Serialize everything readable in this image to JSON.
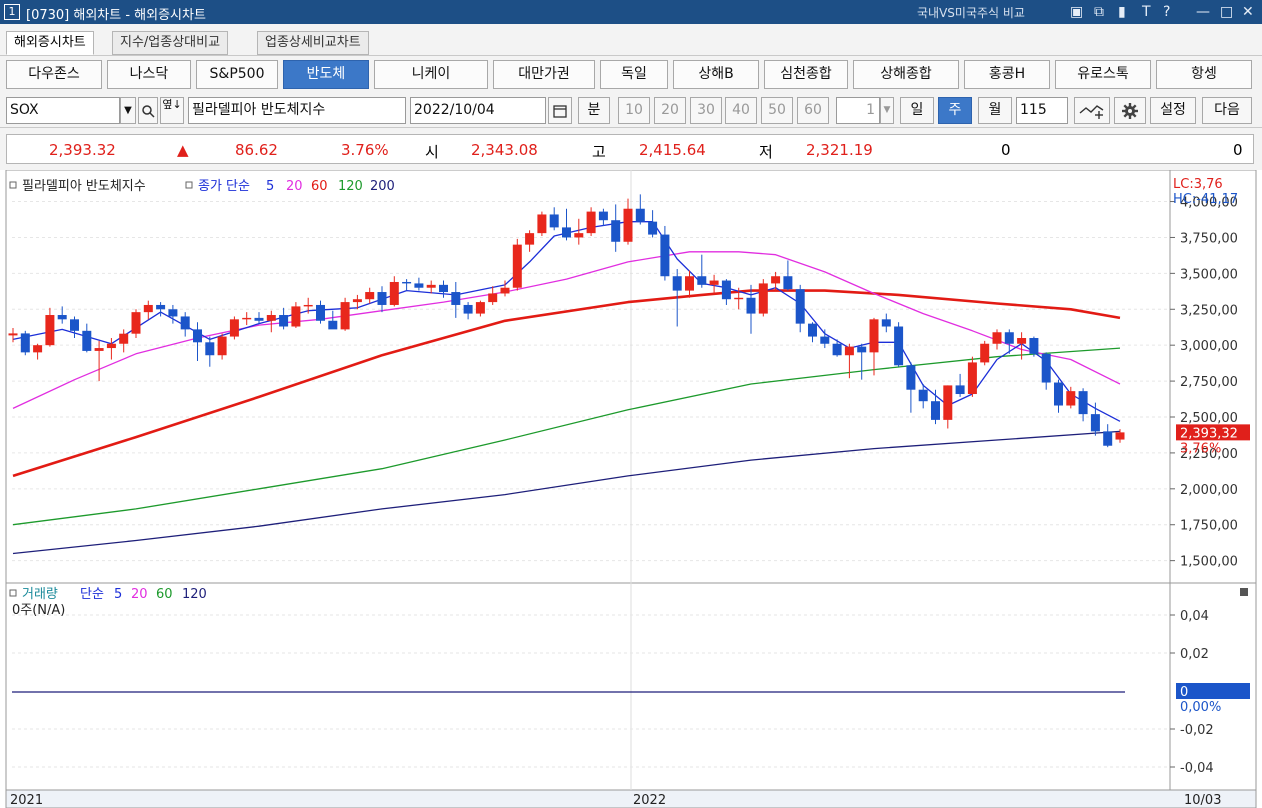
{
  "window": {
    "number": "1",
    "title": "[0730] 해외차트 - 해외증시차트",
    "compare_link": "국내VS미국주식 비교",
    "controls": [
      "▣",
      "⧉",
      "▮",
      "T",
      "?",
      "—",
      "□",
      "✕"
    ]
  },
  "tabs": [
    {
      "label": "해외증시차트",
      "active": true
    },
    {
      "label": "지수/업종상대비교",
      "active": false
    },
    {
      "label": "업종상세비교차트",
      "active": false
    }
  ],
  "index_buttons": [
    {
      "label": "다우존스"
    },
    {
      "label": "나스닥"
    },
    {
      "label": "S&P500"
    },
    {
      "label": "반도체",
      "active": true
    },
    {
      "label": "니케이"
    },
    {
      "label": "대만가권"
    },
    {
      "label": "독일"
    },
    {
      "label": "상해B"
    },
    {
      "label": "심천종합"
    },
    {
      "label": "상해종합"
    },
    {
      "label": "홍콩H"
    },
    {
      "label": "유로스톡"
    },
    {
      "label": "항셍"
    }
  ],
  "toolbar": {
    "symbol": "SOX",
    "symbol_name": "필라델피아 반도체지수",
    "date": "2022/10/04",
    "minute_label": "분",
    "minute_options": [
      "10",
      "20",
      "30",
      "40",
      "50",
      "60"
    ],
    "period_value": "1",
    "day_label": "일",
    "week_label": "주",
    "month_label": "월",
    "count_value": "115",
    "settings_label": "설정",
    "next_label": "다음"
  },
  "quote": {
    "price": "2,393.32",
    "change_arrow": "▲",
    "change": "86.62",
    "change_pct": "3.76%",
    "open_label": "시",
    "open": "2,343.08",
    "high_label": "고",
    "high": "2,415.64",
    "low_label": "저",
    "low": "2,321.19",
    "volume": "0",
    "amount": "0"
  },
  "chart_data": {
    "type": "candlestick",
    "price_legend": {
      "title": "필라델피아 반도체지수",
      "series_label": "종가 단순",
      "periods": [
        "5",
        "20",
        "60",
        "120",
        "200"
      ]
    },
    "volume_legend": {
      "title": "거래량",
      "series_label": "단순",
      "periods": [
        "5",
        "20",
        "60",
        "120"
      ],
      "subtitle": "0주(N/A)"
    },
    "price_axis": {
      "min": 1400,
      "max": 4150,
      "ticks": [
        "1,500,00",
        "1,750,00",
        "2,000,00",
        "2,250,00",
        "2,500,00",
        "2,750,00",
        "3,000,00",
        "3,250,00",
        "3,500,00",
        "3,750,00",
        "4,000,00"
      ]
    },
    "volume_axis": {
      "ticks": [
        "0,04",
        "0,02",
        "-0,02",
        "-0,04"
      ],
      "current_value": "0",
      "current_pct": "0,00%"
    },
    "price_marker": {
      "value": "2,393,32",
      "pct": "3,76%"
    },
    "lc_hc": {
      "lc": "LC:3,76",
      "hc": "HC:-41,17"
    },
    "x_labels": [
      "2021",
      "2022"
    ],
    "x_end_label": "10/03",
    "colors": {
      "up": "#e8271c",
      "down": "#1b55c9",
      "ma5": "#1c2fd8",
      "ma20": "#e12ee0",
      "ma60": "#e21b14",
      "ma120": "#1d9a2c",
      "ma200": "#1e1f7a"
    },
    "candles": [
      [
        3068,
        3120,
        3020,
        3082
      ],
      [
        3082,
        3100,
        2930,
        2950
      ],
      [
        2950,
        3010,
        2900,
        3000
      ],
      [
        3000,
        3260,
        2990,
        3210
      ],
      [
        3210,
        3270,
        3150,
        3180
      ],
      [
        3180,
        3200,
        3050,
        3100
      ],
      [
        3100,
        3150,
        2950,
        2960
      ],
      [
        2960,
        3030,
        2750,
        2980
      ],
      [
        2980,
        3050,
        2900,
        3010
      ],
      [
        3010,
        3110,
        2950,
        3080
      ],
      [
        3080,
        3250,
        3050,
        3230
      ],
      [
        3230,
        3310,
        3180,
        3280
      ],
      [
        3280,
        3300,
        3200,
        3250
      ],
      [
        3250,
        3280,
        3150,
        3200
      ],
      [
        3200,
        3230,
        3060,
        3110
      ],
      [
        3110,
        3160,
        2890,
        3020
      ],
      [
        3020,
        3060,
        2850,
        2930
      ],
      [
        2930,
        3080,
        2900,
        3060
      ],
      [
        3060,
        3200,
        3040,
        3180
      ],
      [
        3180,
        3230,
        3140,
        3190
      ],
      [
        3190,
        3230,
        3150,
        3170
      ],
      [
        3170,
        3240,
        3090,
        3210
      ],
      [
        3210,
        3260,
        3110,
        3130
      ],
      [
        3130,
        3300,
        3120,
        3270
      ],
      [
        3270,
        3330,
        3220,
        3280
      ],
      [
        3280,
        3310,
        3150,
        3170
      ],
      [
        3170,
        3240,
        3160,
        3110
      ],
      [
        3110,
        3330,
        3100,
        3300
      ],
      [
        3300,
        3350,
        3250,
        3320
      ],
      [
        3320,
        3400,
        3290,
        3370
      ],
      [
        3370,
        3410,
        3230,
        3280
      ],
      [
        3280,
        3480,
        3270,
        3440
      ],
      [
        3440,
        3460,
        3380,
        3430
      ],
      [
        3430,
        3470,
        3380,
        3400
      ],
      [
        3400,
        3450,
        3360,
        3420
      ],
      [
        3420,
        3450,
        3330,
        3370
      ],
      [
        3370,
        3440,
        3190,
        3280
      ],
      [
        3280,
        3300,
        3180,
        3220
      ],
      [
        3220,
        3310,
        3200,
        3300
      ],
      [
        3300,
        3410,
        3280,
        3360
      ],
      [
        3360,
        3450,
        3340,
        3400
      ],
      [
        3400,
        3740,
        3380,
        3700
      ],
      [
        3700,
        3800,
        3650,
        3780
      ],
      [
        3780,
        3930,
        3760,
        3910
      ],
      [
        3910,
        3960,
        3800,
        3820
      ],
      [
        3820,
        3950,
        3730,
        3750
      ],
      [
        3750,
        3880,
        3700,
        3780
      ],
      [
        3780,
        3960,
        3760,
        3930
      ],
      [
        3930,
        3950,
        3830,
        3870
      ],
      [
        3870,
        3980,
        3650,
        3720
      ],
      [
        3720,
        4020,
        3700,
        3950
      ],
      [
        3950,
        4050,
        3840,
        3860
      ],
      [
        3860,
        3940,
        3750,
        3770
      ],
      [
        3770,
        3830,
        3450,
        3480
      ],
      [
        3480,
        3530,
        3130,
        3380
      ],
      [
        3380,
        3520,
        3330,
        3480
      ],
      [
        3480,
        3630,
        3400,
        3420
      ],
      [
        3420,
        3490,
        3360,
        3450
      ],
      [
        3450,
        3460,
        3280,
        3320
      ],
      [
        3320,
        3400,
        3250,
        3330
      ],
      [
        3330,
        3420,
        3080,
        3220
      ],
      [
        3220,
        3460,
        3200,
        3430
      ],
      [
        3430,
        3510,
        3380,
        3480
      ],
      [
        3480,
        3590,
        3380,
        3390
      ],
      [
        3390,
        3420,
        3090,
        3150
      ],
      [
        3150,
        3160,
        3020,
        3060
      ],
      [
        3060,
        3110,
        2980,
        3010
      ],
      [
        3010,
        3040,
        2920,
        2930
      ],
      [
        2930,
        3010,
        2770,
        2990
      ],
      [
        2990,
        3010,
        2760,
        2950
      ],
      [
        2950,
        3190,
        2790,
        3180
      ],
      [
        3180,
        3220,
        3090,
        3130
      ],
      [
        3130,
        3160,
        2850,
        2860
      ],
      [
        2860,
        2880,
        2530,
        2690
      ],
      [
        2690,
        2730,
        2560,
        2610
      ],
      [
        2610,
        2690,
        2450,
        2480
      ],
      [
        2480,
        2720,
        2420,
        2720
      ],
      [
        2720,
        2800,
        2640,
        2660
      ],
      [
        2660,
        2920,
        2640,
        2880
      ],
      [
        2880,
        3030,
        2860,
        3010
      ],
      [
        3010,
        3110,
        2970,
        3090
      ],
      [
        3090,
        3110,
        2940,
        3010
      ],
      [
        3010,
        3090,
        2900,
        3050
      ],
      [
        3050,
        3060,
        2920,
        2940
      ],
      [
        2940,
        2950,
        2690,
        2740
      ],
      [
        2740,
        2760,
        2530,
        2580
      ],
      [
        2580,
        2710,
        2560,
        2680
      ],
      [
        2680,
        2700,
        2470,
        2520
      ],
      [
        2520,
        2600,
        2370,
        2400
      ],
      [
        2400,
        2450,
        2290,
        2300
      ],
      [
        2343,
        2416,
        2321,
        2393
      ]
    ],
    "ma_points": {
      "ma5": [
        [
          0,
          3040
        ],
        [
          4,
          3110
        ],
        [
          8,
          3010
        ],
        [
          12,
          3230
        ],
        [
          16,
          3040
        ],
        [
          20,
          3150
        ],
        [
          24,
          3240
        ],
        [
          28,
          3260
        ],
        [
          32,
          3380
        ],
        [
          36,
          3350
        ],
        [
          40,
          3420
        ],
        [
          42,
          3580
        ],
        [
          44,
          3760
        ],
        [
          47,
          3820
        ],
        [
          50,
          3860
        ],
        [
          52,
          3860
        ],
        [
          54,
          3600
        ],
        [
          56,
          3430
        ],
        [
          58,
          3400
        ],
        [
          60,
          3350
        ],
        [
          62,
          3400
        ],
        [
          64,
          3290
        ],
        [
          66,
          3080
        ],
        [
          68,
          2980
        ],
        [
          70,
          3020
        ],
        [
          72,
          3020
        ],
        [
          74,
          2720
        ],
        [
          76,
          2580
        ],
        [
          78,
          2660
        ],
        [
          80,
          2900
        ],
        [
          82,
          3010
        ],
        [
          84,
          2890
        ],
        [
          86,
          2660
        ],
        [
          88,
          2560
        ],
        [
          90,
          2470
        ]
      ],
      "ma20": [
        [
          0,
          2560
        ],
        [
          5,
          2760
        ],
        [
          10,
          2940
        ],
        [
          15,
          3050
        ],
        [
          20,
          3140
        ],
        [
          25,
          3180
        ],
        [
          30,
          3240
        ],
        [
          35,
          3300
        ],
        [
          40,
          3370
        ],
        [
          45,
          3460
        ],
        [
          50,
          3580
        ],
        [
          55,
          3650
        ],
        [
          59,
          3650
        ],
        [
          62,
          3630
        ],
        [
          66,
          3510
        ],
        [
          70,
          3360
        ],
        [
          74,
          3220
        ],
        [
          78,
          3100
        ],
        [
          82,
          2970
        ],
        [
          86,
          2900
        ],
        [
          90,
          2730
        ]
      ],
      "ma60": [
        [
          0,
          2090
        ],
        [
          10,
          2360
        ],
        [
          20,
          2640
        ],
        [
          30,
          2930
        ],
        [
          40,
          3170
        ],
        [
          50,
          3300
        ],
        [
          56,
          3350
        ],
        [
          60,
          3380
        ],
        [
          66,
          3380
        ],
        [
          72,
          3350
        ],
        [
          80,
          3290
        ],
        [
          86,
          3250
        ],
        [
          90,
          3190
        ]
      ],
      "ma120": [
        [
          0,
          1750
        ],
        [
          10,
          1860
        ],
        [
          20,
          2000
        ],
        [
          30,
          2140
        ],
        [
          40,
          2340
        ],
        [
          50,
          2550
        ],
        [
          60,
          2730
        ],
        [
          70,
          2830
        ],
        [
          80,
          2920
        ],
        [
          90,
          2980
        ]
      ],
      "ma200": [
        [
          0,
          1550
        ],
        [
          10,
          1640
        ],
        [
          20,
          1740
        ],
        [
          30,
          1860
        ],
        [
          40,
          1960
        ],
        [
          50,
          2090
        ],
        [
          60,
          2200
        ],
        [
          70,
          2280
        ],
        [
          80,
          2340
        ],
        [
          90,
          2400
        ]
      ]
    }
  }
}
